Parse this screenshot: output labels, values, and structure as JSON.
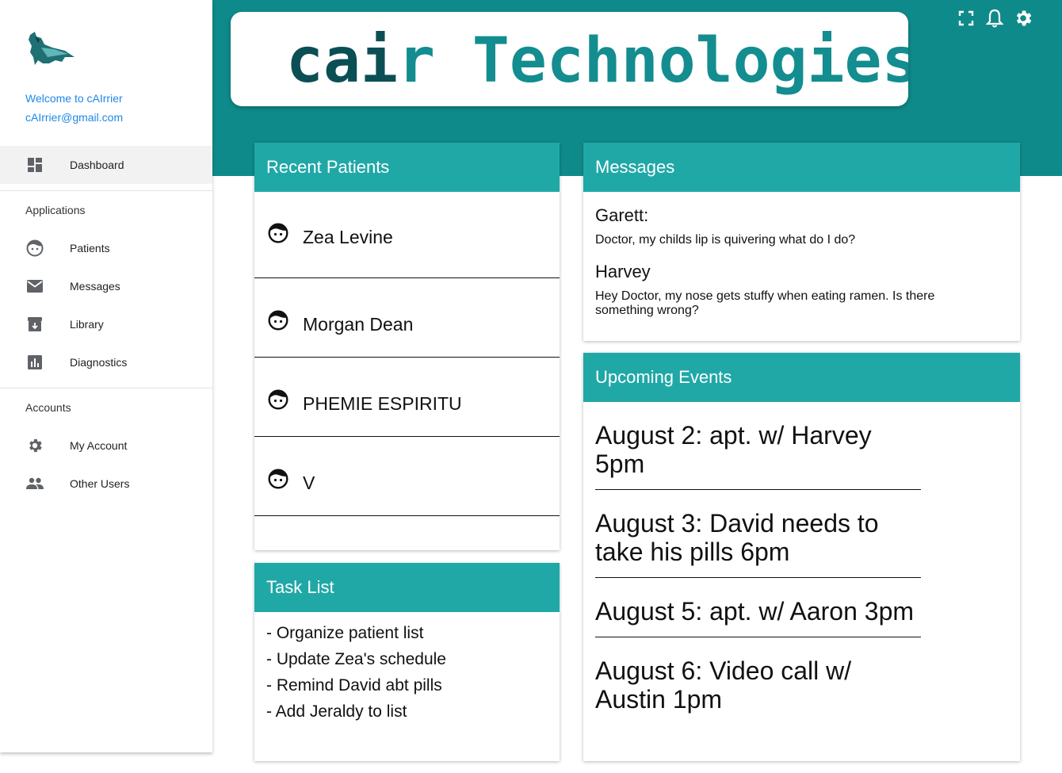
{
  "sidebar": {
    "welcome": "Welcome to cAIrrier",
    "email": "cAIrrier@gmail.com",
    "dashboard": {
      "label": "Dashboard",
      "icon": "dashboard-icon"
    },
    "applications_title": "Applications",
    "applications": [
      {
        "label": "Patients",
        "icon": "face-icon"
      },
      {
        "label": "Messages",
        "icon": "mail-icon"
      },
      {
        "label": "Library",
        "icon": "archive-icon"
      },
      {
        "label": "Diagnostics",
        "icon": "bar-chart-icon"
      }
    ],
    "accounts_title": "Accounts",
    "accounts": [
      {
        "label": "My Account",
        "icon": "gear-icon"
      },
      {
        "label": "Other Users",
        "icon": "people-icon"
      }
    ]
  },
  "header": {
    "brand": {
      "prefix": "c",
      "ai": "ai",
      "suffix": "r Technologies"
    },
    "icons": [
      "fullscreen-icon",
      "bell-icon",
      "gear-icon"
    ]
  },
  "recent_patients": {
    "title": "Recent Patients",
    "items": [
      "Zea Levine",
      "Morgan Dean",
      "PHEMIE ESPIRITU",
      "V"
    ]
  },
  "messages": {
    "title": "Messages",
    "items": [
      {
        "sender": "Garett:",
        "text": "Doctor, my childs lip is quivering what do I do?"
      },
      {
        "sender": "Harvey",
        "text": "Hey Doctor, my nose gets stuffy when eating ramen. Is there something wrong?"
      }
    ]
  },
  "events": {
    "title": "Upcoming Events",
    "items": [
      "August 2: apt. w/ Harvey 5pm",
      "August 3: David needs to take his pills 6pm",
      "August 5: apt. w/ Aaron 3pm",
      "August 6: Video call w/ Austin 1pm"
    ]
  },
  "tasks": {
    "title": "Task List",
    "items": [
      "- Organize patient list",
      "- Update Zea's schedule",
      "- Remind David abt pills",
      "- Add Jeraldy to list"
    ]
  },
  "colors": {
    "header_teal": "#0f8a8a",
    "card_head": "#20a8a7",
    "link_blue": "#1e88e5",
    "brand_dark": "#0b4f55",
    "brand_teal": "#138d8f"
  }
}
